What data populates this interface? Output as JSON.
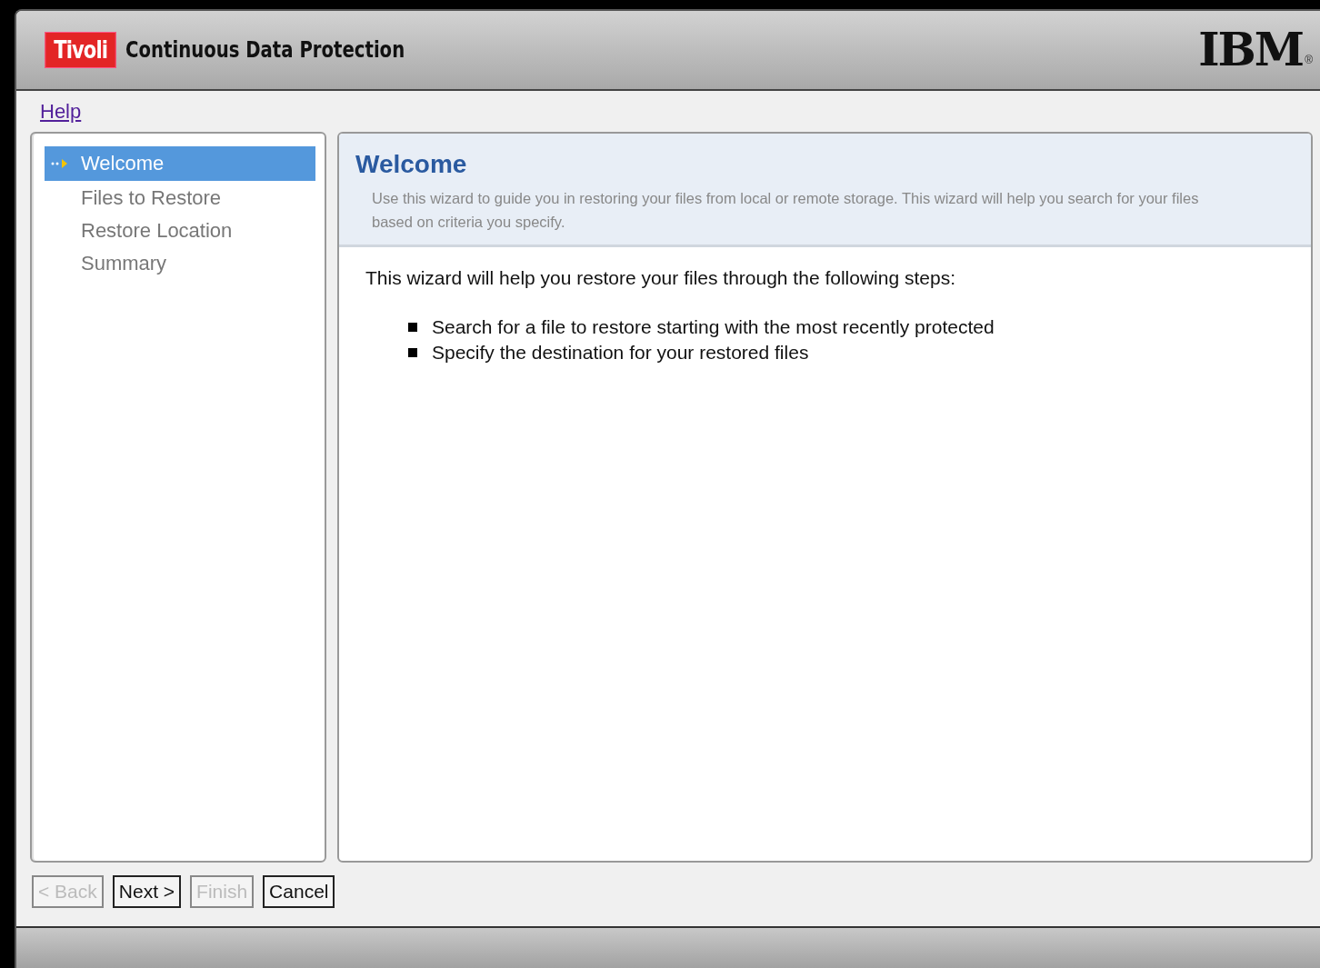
{
  "header": {
    "brand": "Tivoli",
    "title": "Continuous Data Protection",
    "logo": "IBM",
    "registered": "®"
  },
  "help_link": "Help",
  "steps": [
    {
      "label": "Welcome",
      "selected": true
    },
    {
      "label": "Files to Restore",
      "selected": false
    },
    {
      "label": "Restore Location",
      "selected": false
    },
    {
      "label": "Summary",
      "selected": false
    }
  ],
  "page": {
    "title": "Welcome",
    "description": "Use this wizard to guide you in restoring your files from local or remote storage. This wizard will help you search for your files based on criteria you specify.",
    "intro": "This wizard will help you restore your files through the following steps:",
    "bullets": [
      "Search for a file to restore starting with the most recently protected",
      "Specify the destination for your restored files"
    ]
  },
  "buttons": [
    {
      "label": "< Back",
      "disabled": true
    },
    {
      "label": "Next >",
      "disabled": false
    },
    {
      "label": "Finish",
      "disabled": true
    },
    {
      "label": "Cancel",
      "disabled": false
    }
  ]
}
